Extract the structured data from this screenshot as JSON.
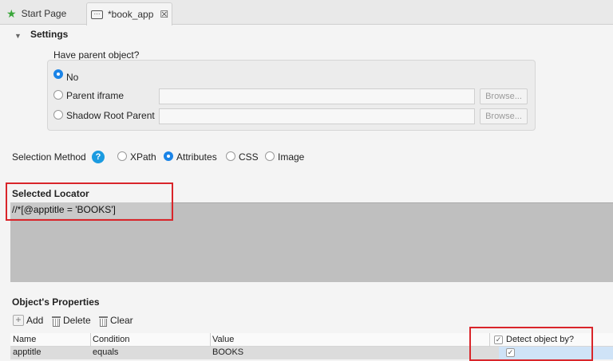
{
  "tabs": [
    {
      "label": "Start Page",
      "icon": "star-icon"
    },
    {
      "label": "*book_app",
      "icon": "object-icon",
      "close": "☒"
    }
  ],
  "settings": {
    "title": "Settings",
    "parent_question": "Have parent object?",
    "options": [
      {
        "label": "No",
        "selected": true
      },
      {
        "label": "Parent iframe",
        "selected": false
      },
      {
        "label": "Shadow Root Parent",
        "selected": false
      }
    ],
    "browse_label": "Browse..."
  },
  "selection": {
    "label": "Selection Method",
    "help": "?",
    "methods": [
      {
        "label": "XPath",
        "selected": false
      },
      {
        "label": "Attributes",
        "selected": true
      },
      {
        "label": "CSS",
        "selected": false
      },
      {
        "label": "Image",
        "selected": false
      }
    ]
  },
  "locator": {
    "title": "Selected Locator",
    "value": "//*[@apptitle = 'BOOKS']"
  },
  "properties": {
    "title": "Object's Properties",
    "toolbar": {
      "add": "Add",
      "delete": "Delete",
      "clear": "Clear"
    },
    "columns": [
      "Name",
      "Condition",
      "Value",
      "Detect object by?"
    ],
    "rows": [
      {
        "name": "apptitle",
        "condition": "equals",
        "value": "BOOKS",
        "detect": true
      }
    ]
  },
  "colors": {
    "accent": "#1b84e7",
    "highlight": "#d9252a"
  }
}
